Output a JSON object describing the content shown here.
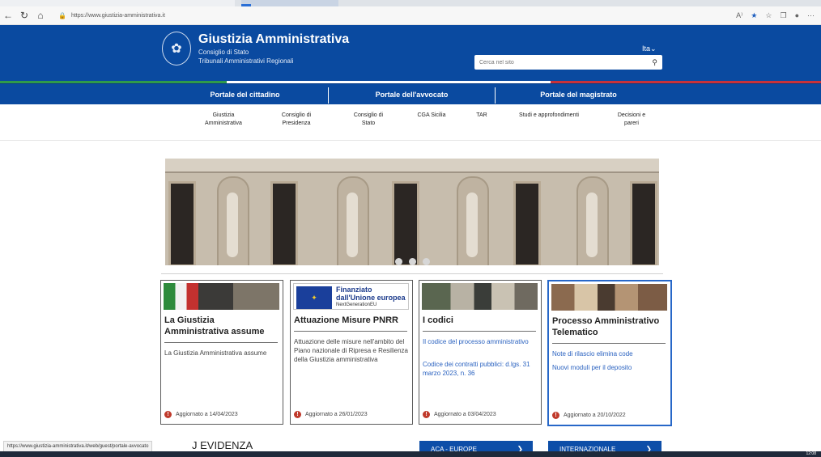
{
  "browser": {
    "url": "https://www.giustizia-amministrativa.it"
  },
  "header": {
    "title": "Giustizia Amministrativa",
    "subtitle1": "Consiglio di Stato",
    "subtitle2": "Tribunali Amministrativi Regionali",
    "lang": "Ita",
    "search_placeholder": "Cerca nel sito"
  },
  "portals": [
    "Portale del cittadino",
    "Portale dell'avvocato",
    "Portale del magistrato"
  ],
  "subnav": [
    [
      "Giustizia",
      "Amministrativa"
    ],
    [
      "Consiglio di",
      "Presidenza"
    ],
    [
      "Consiglio di",
      "Stato"
    ],
    [
      "CGA Sicilia",
      ""
    ],
    [
      "TAR",
      ""
    ],
    [
      "Studi e approfondimenti",
      ""
    ],
    [
      "Decisioni e",
      "pareri"
    ]
  ],
  "cards": [
    {
      "title": "La Giustizia Amministrativa assume",
      "text": "La Giustizia Amministrativa assume",
      "updated": "Aggiornato a 14/04/2023"
    },
    {
      "title": "Attuazione Misure PNRR",
      "text": "Attuazione delle misure nell'ambito del Piano nazionale di Ripresa e Resilienza della Giustizia amministrativa",
      "updated": "Aggiornato a 26/01/2023",
      "eu_line1": "Finanziato",
      "eu_line2": "dall'Unione europea",
      "eu_line3": "NextGenerationEU"
    },
    {
      "title": "I codici",
      "link1": "Il codice del processo amministrativo",
      "link2": "Codice dei contratti pubblici: d.lgs. 31 marzo 2023, n. 36",
      "updated": "Aggiornato a 03/04/2023"
    },
    {
      "title": "Processo Amministrativo Telematico",
      "link1": "Note di rilascio elimina code",
      "link2": "Nuovi moduli per il deposito",
      "updated": "Aggiornato a 20/10/2022"
    }
  ],
  "bottom": {
    "evidenza": "J EVIDENZA",
    "btn1": "ACA - EUROPE",
    "btn2": "INTERNAZIONALE",
    "status_url": "https://www.giustizia-amministrativa.it/web/guest/portale-avvocato",
    "clock": "12:08"
  }
}
